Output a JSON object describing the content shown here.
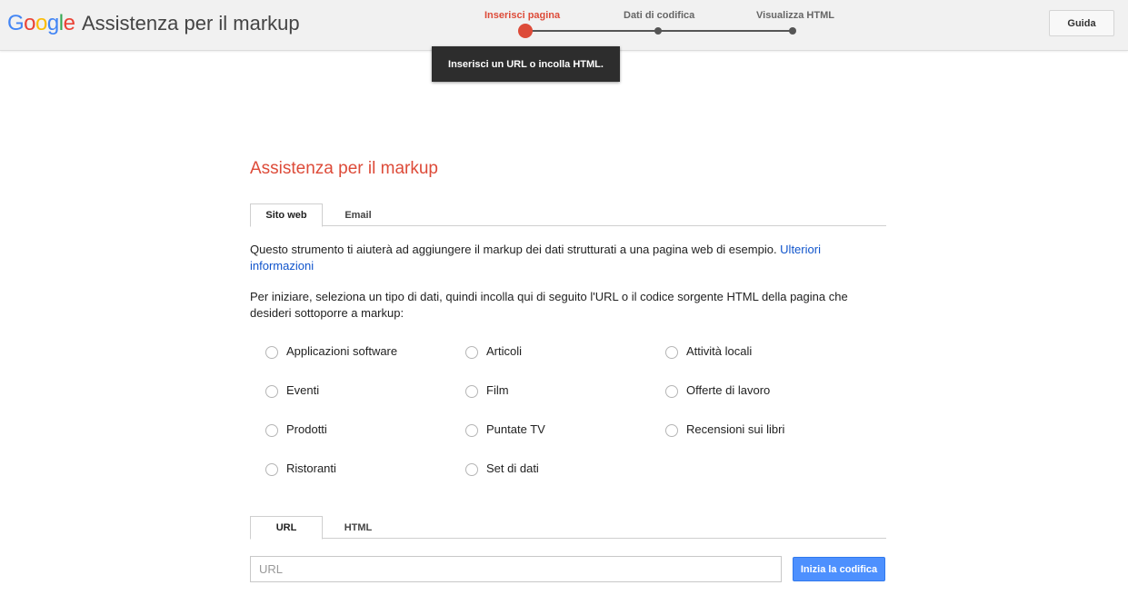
{
  "header": {
    "logo": {
      "letters": [
        {
          "char": "G",
          "color": "#4285f4"
        },
        {
          "char": "o",
          "color": "#ea4335"
        },
        {
          "char": "o",
          "color": "#fbbc05"
        },
        {
          "char": "g",
          "color": "#4285f4"
        },
        {
          "char": "l",
          "color": "#34a853"
        },
        {
          "char": "e",
          "color": "#ea4335"
        }
      ]
    },
    "app_title": "Assistenza per il markup",
    "steps": [
      {
        "label": "Inserisci pagina",
        "active": true
      },
      {
        "label": "Dati di codifica",
        "active": false
      },
      {
        "label": "Visualizza HTML",
        "active": false
      }
    ],
    "help_label": "Guida"
  },
  "tooltip": "Inserisci un URL o incolla HTML.",
  "main": {
    "title": "Assistenza per il markup",
    "tabs": [
      {
        "label": "Sito web",
        "active": true
      },
      {
        "label": "Email",
        "active": false
      }
    ],
    "intro_text": "Questo strumento ti aiuterà ad aggiungere il markup dei dati strutturati a una pagina web di esempio. ",
    "intro_link": "Ulteriori informazioni",
    "instructions": "Per iniziare, seleziona un tipo di dati, quindi incolla qui di seguito l'URL o il codice sorgente HTML della pagina che desideri sottoporre a markup:",
    "data_types": [
      "Applicazioni software",
      "Articoli",
      "Attività locali",
      "Eventi",
      "Film",
      "Offerte di lavoro",
      "Prodotti",
      "Puntate TV",
      "Recensioni sui libri",
      "Ristoranti",
      "Set di dati"
    ],
    "input_tabs": [
      {
        "label": "URL",
        "active": true
      },
      {
        "label": "HTML",
        "active": false
      }
    ],
    "url_placeholder": "URL",
    "url_value": "",
    "start_button": "Inizia la codifica"
  },
  "colors": {
    "accent_red": "#dd4b39",
    "button_blue": "#4d90fe",
    "link_blue": "#1155cc"
  }
}
